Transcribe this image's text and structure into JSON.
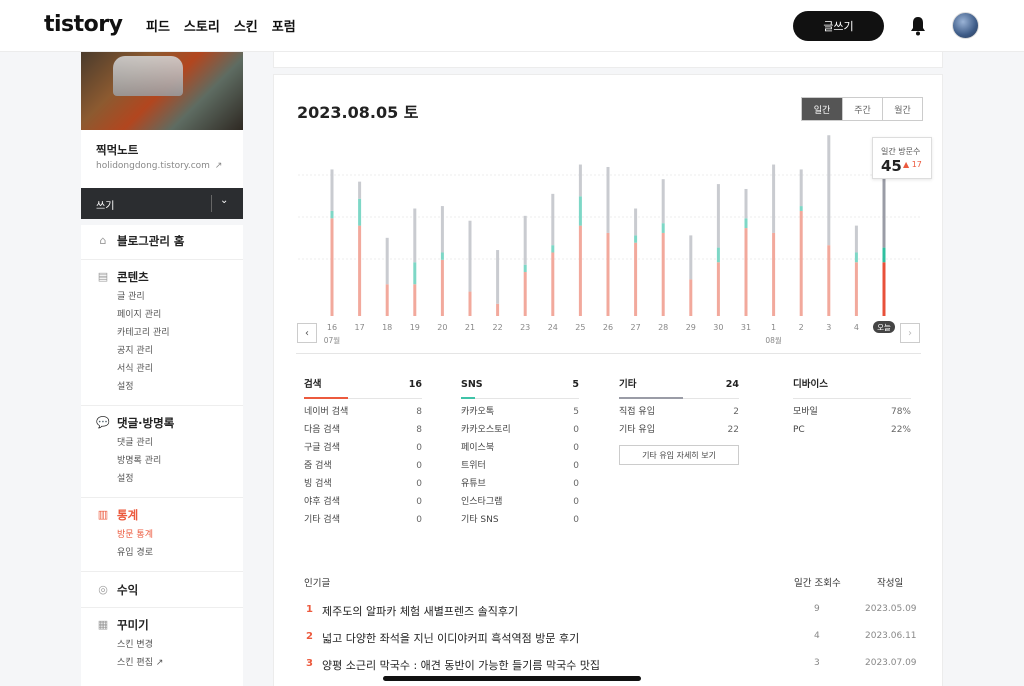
{
  "header": {
    "logo": "tistory",
    "nav": [
      "피드",
      "스토리",
      "스킨",
      "포럼"
    ],
    "write_button": "글쓰기"
  },
  "sidebar": {
    "blog_name": "찍먹노트",
    "blog_url": "holidongdong.tistory.com",
    "write_label": "쓰기",
    "sections": [
      {
        "title": "블로그관리 홈",
        "icon": "home-icon",
        "items": []
      },
      {
        "title": "콘텐츠",
        "icon": "document-icon",
        "items": [
          "글 관리",
          "페이지 관리",
          "카테고리 관리",
          "공지 관리",
          "서식 관리",
          "설정"
        ]
      },
      {
        "title": "댓글·방명록",
        "icon": "comment-icon",
        "items": [
          "댓글 관리",
          "방명록 관리",
          "설정"
        ]
      },
      {
        "title": "통계",
        "icon": "chart-icon",
        "items": [
          "방문 통계",
          "유입 경로"
        ],
        "active": true,
        "current": "방문 통계"
      },
      {
        "title": "수익",
        "icon": "coins-icon",
        "items": []
      },
      {
        "title": "꾸미기",
        "icon": "layout-icon",
        "items": [
          "스킨 변경",
          "스킨 편집"
        ]
      }
    ]
  },
  "main": {
    "date": "2023.08.05 토",
    "period_tabs": [
      "일간",
      "주간",
      "월간"
    ],
    "selected_period": "일간",
    "tooltip": {
      "title": "일간 방문수",
      "value": "45",
      "delta": "17"
    },
    "month_labels": [
      {
        "label": "07월",
        "under": "16"
      },
      {
        "label": "08월",
        "under": "1"
      }
    ],
    "today_label": "오늘"
  },
  "chart_data": {
    "type": "bar",
    "title": "",
    "categories": [
      "16",
      "17",
      "18",
      "19",
      "20",
      "21",
      "22",
      "23",
      "24",
      "25",
      "26",
      "27",
      "28",
      "29",
      "30",
      "31",
      "1",
      "2",
      "3",
      "4",
      "오늘"
    ],
    "series": [
      {
        "name": "검색",
        "color": "#f2a99c",
        "values": [
          40,
          37,
          13,
          13,
          23,
          10,
          5,
          18,
          26,
          37,
          34,
          30,
          34,
          15,
          22,
          36,
          34,
          43,
          29,
          22,
          22
        ]
      },
      {
        "name": "SNS",
        "color": "#7ed7c6",
        "values": [
          3,
          11,
          0,
          9,
          3,
          0,
          0,
          3,
          3,
          12,
          0,
          3,
          4,
          0,
          6,
          4,
          0,
          2,
          0,
          4,
          6
        ]
      },
      {
        "name": "기타",
        "color": "#c9cbd0",
        "values": [
          17,
          7,
          19,
          22,
          19,
          29,
          22,
          20,
          21,
          13,
          27,
          11,
          18,
          18,
          26,
          12,
          28,
          15,
          45,
          11,
          34
        ]
      }
    ],
    "ylim": [
      0,
      70
    ]
  },
  "sources": [
    {
      "title": "검색",
      "total": "16",
      "color": "#ec5a3e",
      "rows": [
        [
          "네이버 검색",
          "8"
        ],
        [
          "다음 검색",
          "8"
        ],
        [
          "구글 검색",
          "0"
        ],
        [
          "줌 검색",
          "0"
        ],
        [
          "빙 검색",
          "0"
        ],
        [
          "야후 검색",
          "0"
        ],
        [
          "기타 검색",
          "0"
        ]
      ]
    },
    {
      "title": "SNS",
      "total": "5",
      "color": "#3fc3a8",
      "rows": [
        [
          "카카오톡",
          "5"
        ],
        [
          "카카오스토리",
          "0"
        ],
        [
          "페이스북",
          "0"
        ],
        [
          "트위터",
          "0"
        ],
        [
          "유튜브",
          "0"
        ],
        [
          "인스타그램",
          "0"
        ],
        [
          "기타 SNS",
          "0"
        ]
      ]
    },
    {
      "title": "기타",
      "total": "24",
      "color": "#9a9ca6",
      "rows": [
        [
          "직접 유입",
          "2"
        ],
        [
          "기타 유입",
          "22"
        ]
      ],
      "button": "기타 유입 자세히 보기"
    },
    {
      "title": "디바이스",
      "total": "",
      "color": "#e5e5e5",
      "rows": [
        [
          "모바일",
          "78%"
        ],
        [
          "PC",
          "22%"
        ]
      ]
    }
  ],
  "popular": {
    "headers": {
      "title": "인기글",
      "views": "일간 조회수",
      "date": "작성일"
    },
    "rows": [
      {
        "rank": "1",
        "title": "제주도의 알파카 체험 새별프렌즈 솔직후기",
        "views": "9",
        "date": "2023.05.09"
      },
      {
        "rank": "2",
        "title": "넓고 다양한 좌석을 지닌 이디야커피 흑석역점 방문 후기",
        "views": "4",
        "date": "2023.06.11"
      },
      {
        "rank": "3",
        "title": "양평 소근리 막국수 : 애견 동반이 가능한 들기름 막국수 맛집",
        "views": "3",
        "date": "2023.07.09"
      }
    ]
  }
}
